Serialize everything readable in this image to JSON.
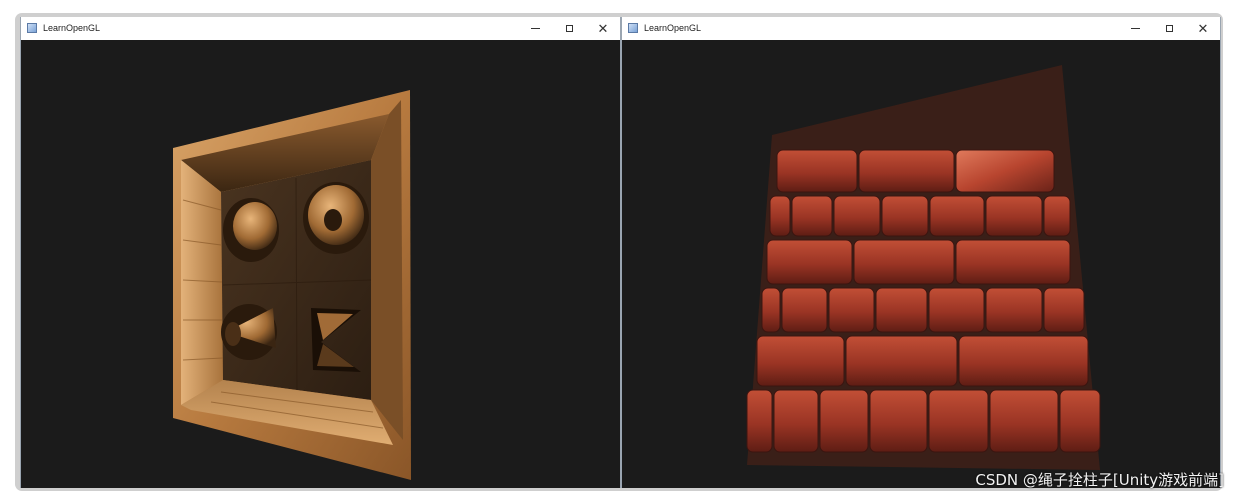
{
  "windows": [
    {
      "title": "LearnOpenGL",
      "controls": {
        "minimize": "minimize-icon",
        "maximize": "maximize-icon",
        "close": "close-icon"
      }
    },
    {
      "title": "LearnOpenGL",
      "controls": {
        "minimize": "minimize-icon",
        "maximize": "maximize-icon",
        "close": "close-icon"
      }
    }
  ],
  "watermark": "CSDN @绳子拴柱子[Unity游戏前端]",
  "colors": {
    "viewport_bg": "#1b1b1b",
    "wood": "#c58a4e",
    "brick": "#a23b2a"
  }
}
